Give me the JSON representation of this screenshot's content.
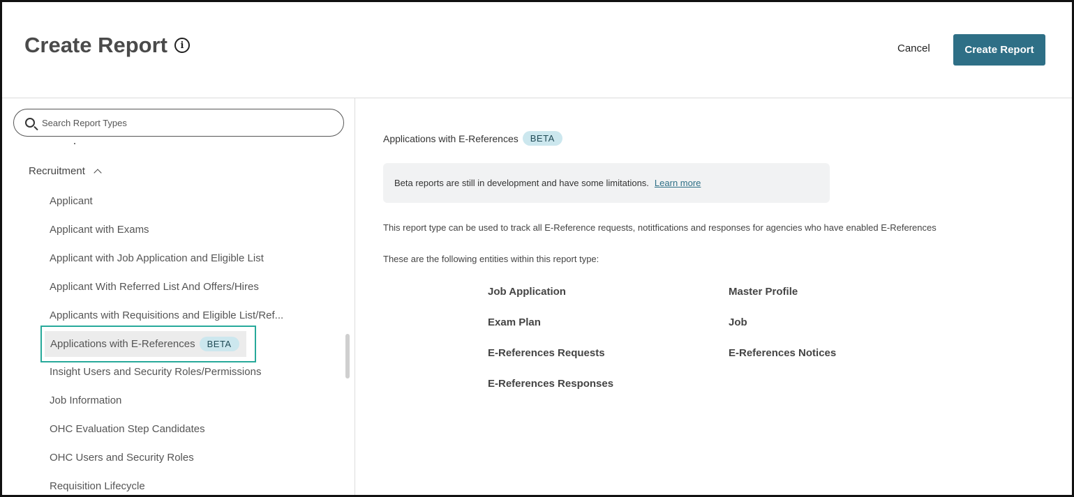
{
  "header": {
    "title": "Create Report",
    "info_icon": "info-icon",
    "cancel_label": "Cancel",
    "create_label": "Create Report"
  },
  "sidebar": {
    "search": {
      "placeholder": "Search Report Types",
      "value": "",
      "icon": "search-icon"
    },
    "section": {
      "label": "Recruitment",
      "icon": "chevron-up-icon",
      "expanded": true
    },
    "items": [
      {
        "label": "Applicant"
      },
      {
        "label": "Applicant with Exams"
      },
      {
        "label": "Applicant with Job Application and Eligible List"
      },
      {
        "label": "Applicant With Referred List And Offers/Hires"
      },
      {
        "label": "Applicants with Requisitions and Eligible List/Ref..."
      },
      {
        "label": "Applications with E-References",
        "badge": "BETA",
        "selected": true
      },
      {
        "label": "Insight Users and Security Roles/Permissions"
      },
      {
        "label": "Job Information"
      },
      {
        "label": "OHC Evaluation Step Candidates"
      },
      {
        "label": "OHC Users and Security Roles"
      },
      {
        "label": "Requisition Lifecycle"
      }
    ]
  },
  "detail": {
    "title": "Applications with E-References",
    "badge": "BETA",
    "notice_text": "Beta reports are still in development and have some limitations.",
    "learn_more": "Learn more",
    "description": "This report type can be used to track all E-Reference requests, notitfications and responses for agencies who have enabled E-References",
    "entities_intro": "These are the following entities within this report type:",
    "entities": [
      "Job Application",
      "Master Profile",
      "Exam Plan",
      "Job",
      "E-References Requests",
      "E-References Notices",
      "E-References Responses"
    ]
  },
  "colors": {
    "primary_button": "#2e6f86",
    "selection_border": "#27a99a",
    "beta_badge_bg": "#cce7ee"
  }
}
